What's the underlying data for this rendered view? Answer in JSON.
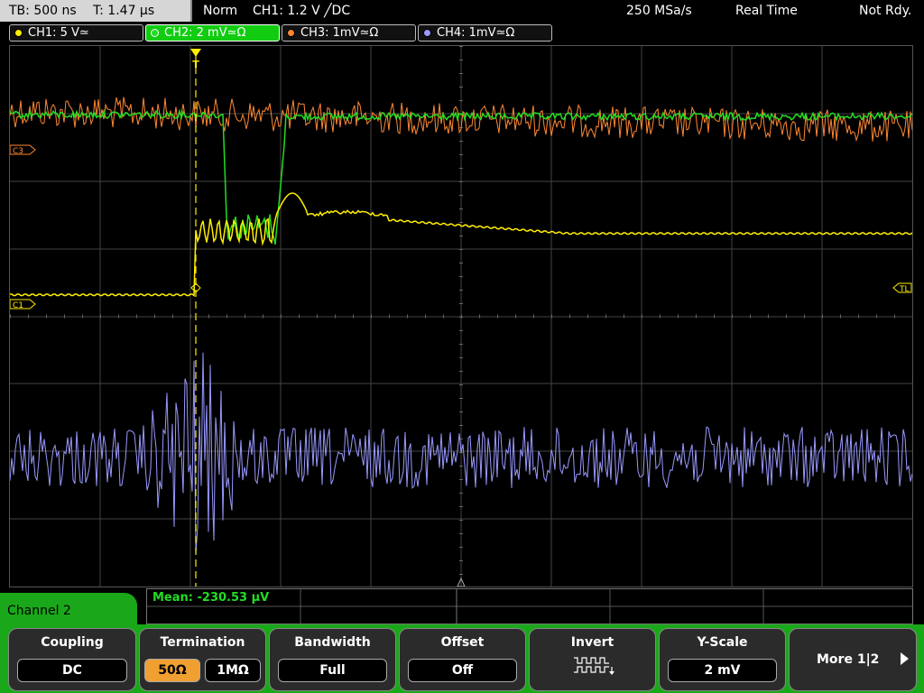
{
  "topbar": {
    "timebase": "TB: 500 ns",
    "trigger_time": "T: 1.47 µs",
    "trigger_mode": "Norm",
    "trigger_info": "CH1: 1.2 V ╱DC",
    "sample_rate": "250 MSa/s",
    "acquisition": "Real Time",
    "status": "Not Rdy."
  },
  "channels": [
    {
      "label": "CH1: 5 V≃",
      "color": "#ffee00",
      "active": false
    },
    {
      "label": "CH2: 2 mV≃Ω",
      "color": "#22dd22",
      "active": true
    },
    {
      "label": "CH3: 1mV≃Ω",
      "color": "#ff8833",
      "active": false
    },
    {
      "label": "CH4: 1mV≃Ω",
      "color": "#9999ff",
      "active": false
    }
  ],
  "markers": {
    "c3": "C3",
    "c1": "C1",
    "tl": "TL",
    "trigger_t": "T"
  },
  "measurement": {
    "text": "Mean: -230.53 µV"
  },
  "menu": {
    "title": "Channel 2",
    "coupling": {
      "label": "Coupling",
      "value": "DC"
    },
    "termination": {
      "label": "Termination",
      "options": [
        "50Ω",
        "1MΩ"
      ],
      "selected": "50Ω"
    },
    "bandwidth": {
      "label": "Bandwidth",
      "value": "Full"
    },
    "offset": {
      "label": "Offset",
      "value": "Off"
    },
    "invert": {
      "label": "Invert"
    },
    "yscale": {
      "label": "Y-Scale",
      "value": "2 mV"
    },
    "more": {
      "label": "More 1|2"
    }
  },
  "colors": {
    "ch1": "#ffee00",
    "ch2": "#22dd22",
    "ch3": "#ff8833",
    "ch4": "#9999ff",
    "menu_green": "#1aa81a",
    "selected_orange": "#f0a030"
  }
}
